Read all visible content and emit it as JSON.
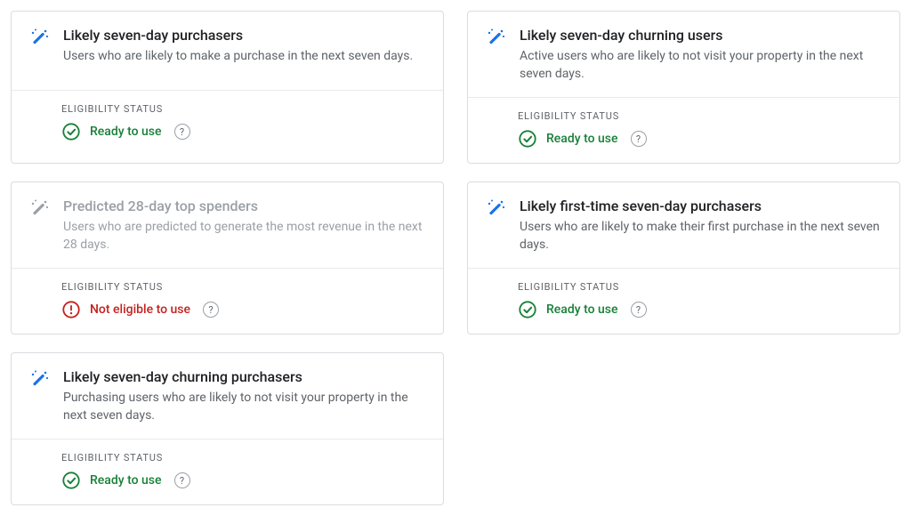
{
  "status_label": "ELIGIBILITY STATUS",
  "status_ready": "Ready to use",
  "status_not_eligible": "Not eligible to use",
  "cards": [
    {
      "title": "Likely seven-day purchasers",
      "desc": "Users who are likely to make a purchase in the next seven days.",
      "status": "ready",
      "disabled": false
    },
    {
      "title": "Likely seven-day churning users",
      "desc": "Active users who are likely to not visit your property in the next seven days.",
      "status": "ready",
      "disabled": false
    },
    {
      "title": "Predicted 28-day top spenders",
      "desc": "Users who are predicted to generate the most revenue in the next 28 days.",
      "status": "not_eligible",
      "disabled": true
    },
    {
      "title": "Likely first-time seven-day purchasers",
      "desc": "Users who are likely to make their first purchase in the next seven days.",
      "status": "ready",
      "disabled": false
    },
    {
      "title": "Likely seven-day churning purchasers",
      "desc": "Purchasing users who are likely to not visit your property in the next seven days.",
      "status": "ready",
      "disabled": false
    }
  ],
  "colors": {
    "ready": "#188038",
    "error": "#c5221f",
    "wand_active": "#1a73e8",
    "wand_disabled": "#9aa0a6"
  }
}
